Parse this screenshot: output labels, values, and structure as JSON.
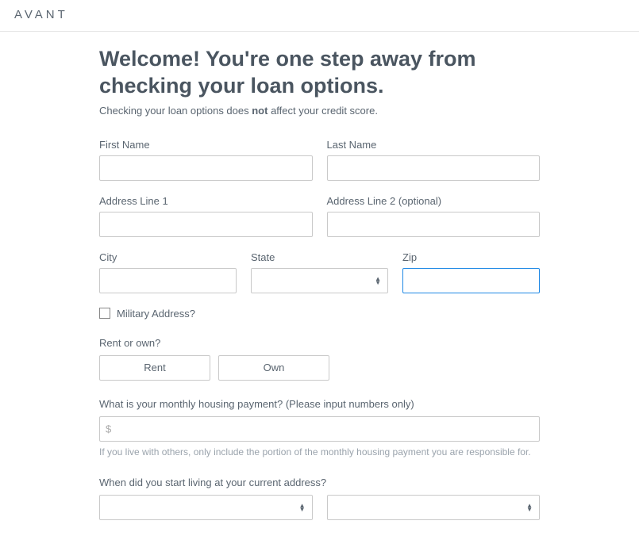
{
  "brand": {
    "logo_text": "AVANT"
  },
  "page": {
    "title": "Welcome! You're one step away from checking your loan options.",
    "subtext_pre": "Checking your loan options does ",
    "subtext_bold": "not",
    "subtext_post": " affect your credit score."
  },
  "fields": {
    "first_name": {
      "label": "First Name",
      "value": ""
    },
    "last_name": {
      "label": "Last Name",
      "value": ""
    },
    "address1": {
      "label": "Address Line 1",
      "value": ""
    },
    "address2": {
      "label": "Address Line 2 (optional)",
      "value": ""
    },
    "city": {
      "label": "City",
      "value": ""
    },
    "state": {
      "label": "State",
      "value": ""
    },
    "zip": {
      "label": "Zip",
      "value": ""
    },
    "military": {
      "label": "Military Address?"
    },
    "rent_own": {
      "label": "Rent or own?",
      "option_rent": "Rent",
      "option_own": "Own"
    },
    "housing_payment": {
      "label": "What is your monthly housing payment? (Please input numbers only)",
      "prefix": "$",
      "value": "",
      "helper": "If you live with others, only include the portion of the monthly housing payment you are responsible for."
    },
    "move_in": {
      "label": "When did you start living at your current address?"
    }
  }
}
